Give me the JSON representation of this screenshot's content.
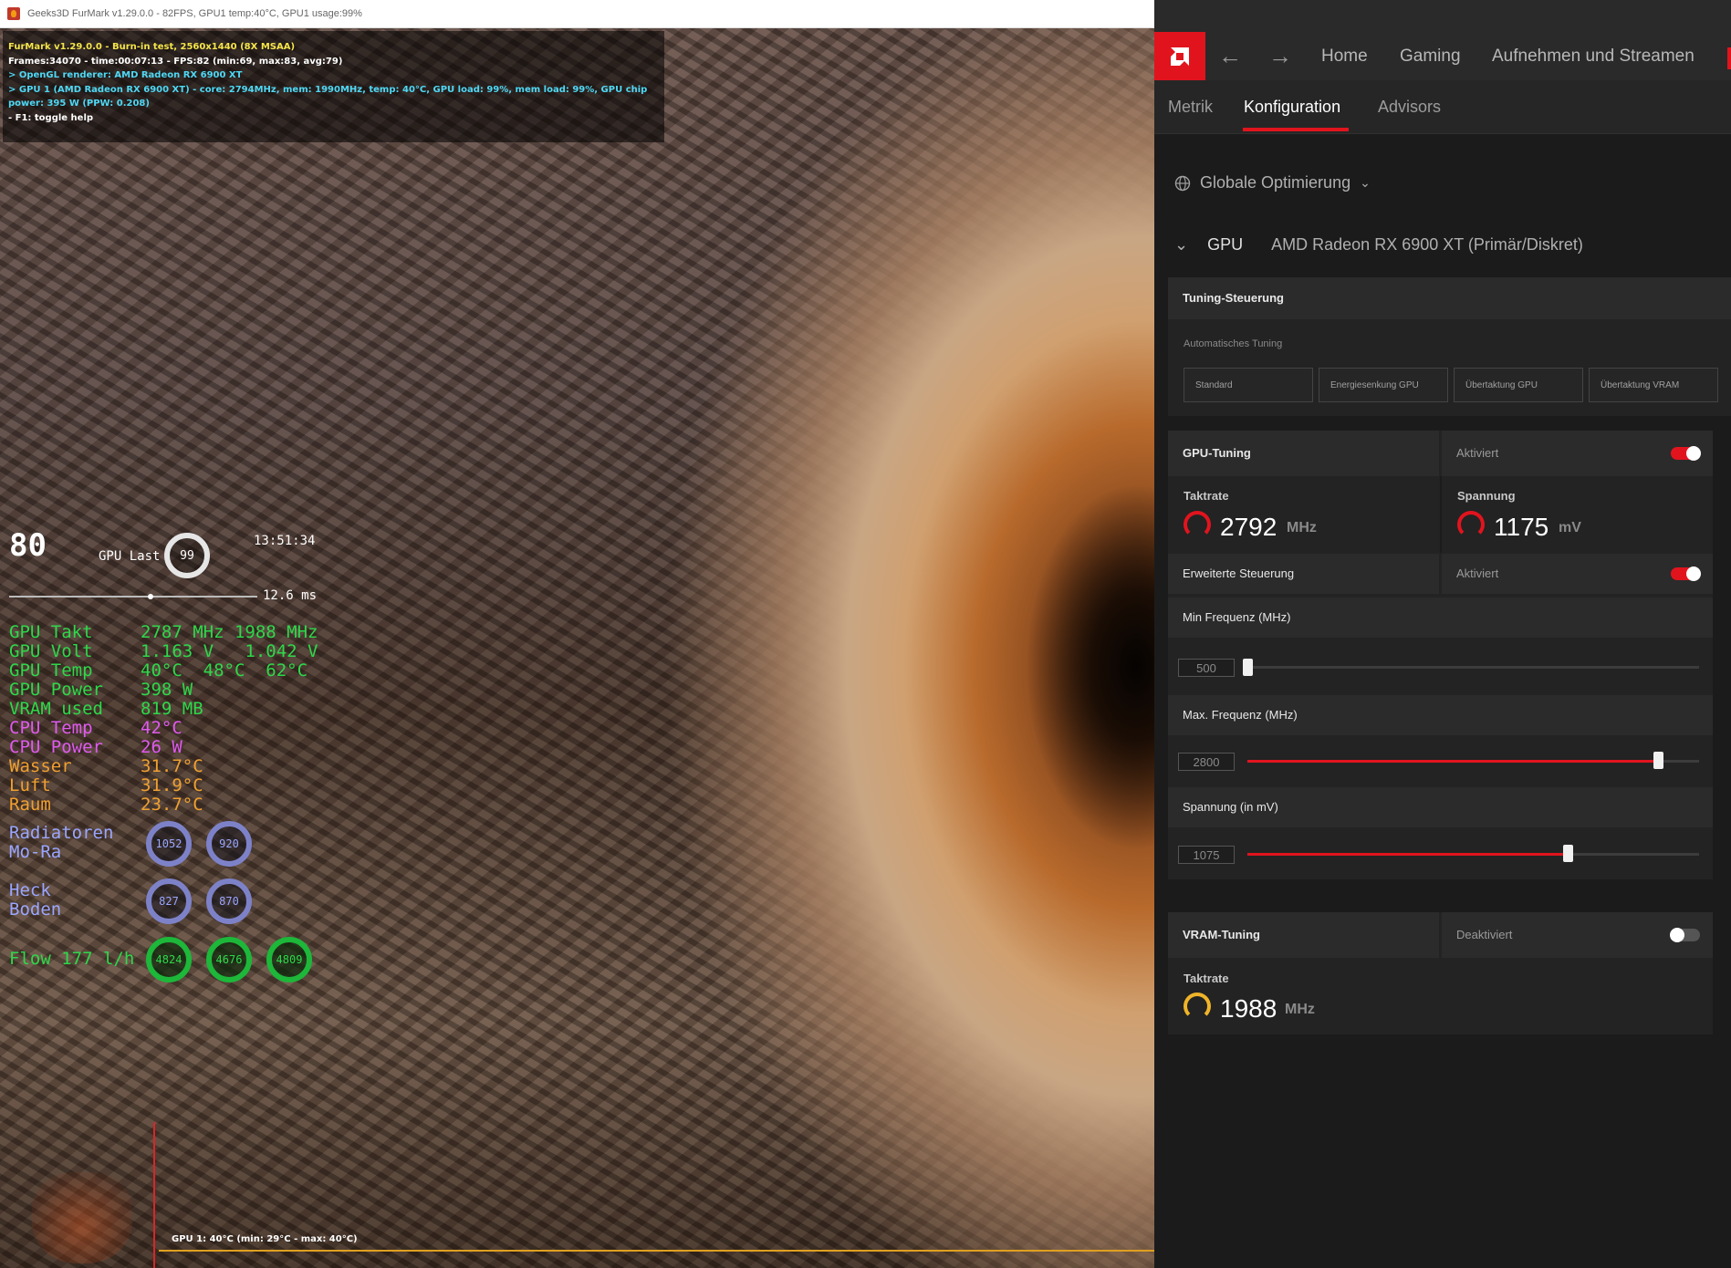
{
  "furmark": {
    "window_title": "Geeks3D FurMark v1.29.0.0 - 82FPS, GPU1 temp:40°C, GPU1 usage:99%",
    "info_lines": [
      "FurMark v1.29.0.0 - Burn-in test, 2560x1440 (8X MSAA)",
      "Frames:34070 - time:00:07:13 - FPS:82 (min:69, max:83, avg:79)",
      "> OpenGL renderer: AMD Radeon RX 6900 XT",
      "> GPU 1 (AMD Radeon RX 6900 XT) - core: 2794MHz, mem: 1990MHz, temp: 40°C, GPU load: 99%, mem load: 99%, GPU chip power: 395 W (PPW: 0.208)",
      "- F1: toggle help"
    ],
    "graph_label": "GPU 1: 40°C (min: 29°C - max: 40°C)"
  },
  "osd": {
    "fps": "80",
    "gpu_last_label": "GPU Last",
    "gpu_last_value": "99",
    "clock": "13:51:34",
    "frametime": "12.6 ms",
    "rows": [
      {
        "label": "GPU Takt",
        "value": "2787 MHz 1988 MHz"
      },
      {
        "label": "GPU Volt",
        "value": "1.163 V   1.042 V"
      },
      {
        "label": "GPU Temp",
        "value": "40°C  48°C  62°C"
      },
      {
        "label": "GPU Power",
        "value": "398 W"
      },
      {
        "label": "VRAM used",
        "value": "819 MB"
      },
      {
        "label": "CPU Temp",
        "value": "42°C"
      },
      {
        "label": "CPU Power",
        "value": "26 W"
      },
      {
        "label": "Wasser",
        "value": "31.7°C"
      },
      {
        "label": "Luft",
        "value": "31.9°C"
      },
      {
        "label": "Raum",
        "value": "23.7°C"
      }
    ],
    "fans_1_label": [
      "Radiatoren",
      "Mo-Ra"
    ],
    "fans_1": [
      "1052",
      "920"
    ],
    "fans_2_label": [
      "Heck",
      "Boden"
    ],
    "fans_2": [
      "827",
      "870"
    ],
    "flow_label": "Flow 177 l/h",
    "pumps": [
      "4824",
      "4676",
      "4809"
    ]
  },
  "amd": {
    "nav": [
      "Home",
      "Gaming",
      "Aufnehmen und Streamen"
    ],
    "subtabs": [
      "Metrik",
      "Konfiguration",
      "Advisors"
    ],
    "active_subtab": "Konfiguration",
    "globale": "Globale Optimierung",
    "gpu_label": "GPU",
    "gpu_name": "AMD Radeon RX 6900 XT (Primär/Diskret)",
    "tuning_header": "Tuning-Steuerung",
    "auto_tuning_label": "Automatisches Tuning",
    "tuning_buttons": [
      "Standard",
      "Energiesenkung GPU",
      "Übertaktung GPU",
      "Übertaktung VRAM"
    ],
    "gpu_tuning": {
      "label": "GPU-Tuning",
      "status": "Aktiviert",
      "enabled": true,
      "takt_label": "Taktrate",
      "takt_value": "2792",
      "takt_unit": "MHz",
      "spannung_label": "Spannung",
      "spannung_value": "1175",
      "spannung_unit": "mV",
      "advanced_label": "Erweiterte Steuerung",
      "advanced_status": "Aktiviert",
      "min_freq_label": "Min Frequenz (MHz)",
      "min_freq_value": "500",
      "min_freq_fraction": 0.0,
      "max_freq_label": "Max. Frequenz (MHz)",
      "max_freq_value": "2800",
      "max_freq_fraction": 0.91,
      "voltage_label": "Spannung (in mV)",
      "voltage_value": "1075",
      "voltage_fraction": 0.71
    },
    "vram_tuning": {
      "label": "VRAM-Tuning",
      "status": "Deaktiviert",
      "enabled": false,
      "takt_label": "Taktrate",
      "takt_value": "1988",
      "takt_unit": "MHz"
    },
    "accent_color": "#e1141e"
  }
}
